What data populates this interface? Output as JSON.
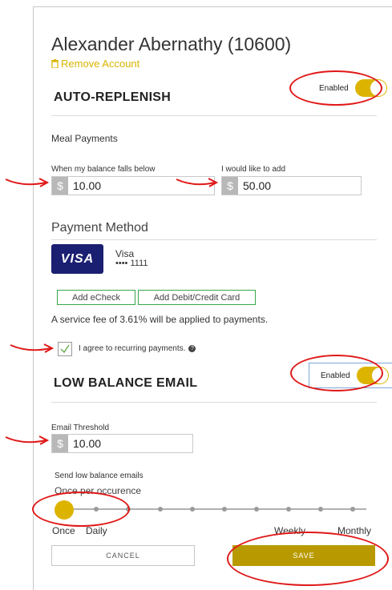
{
  "account": {
    "title": "Alexander Abernathy (10600)",
    "remove_label": "Remove Account"
  },
  "auto_replenish": {
    "heading": "AUTO-REPLENISH",
    "toggle_label": "Enabled",
    "meal_payments_label": "Meal Payments",
    "balance_falls_label": "When my balance falls below",
    "balance_falls_value": "10.00",
    "add_label": "I would like to add",
    "add_value": "50.00",
    "currency_symbol": "$"
  },
  "payment_method": {
    "heading": "Payment Method",
    "card_brand_logo": "VISA",
    "card_name": "Visa",
    "card_masked": "•••• 1111",
    "add_echeck_label": "Add eCheck",
    "add_card_label": "Add Debit/Credit Card",
    "fee_notice": "A service fee of 3.61% will be applied to payments.",
    "agree_label": "I agree to recurring payments.",
    "agree_checked": true,
    "help_icon": "question-circle-icon"
  },
  "low_balance": {
    "heading": "LOW BALANCE EMAIL",
    "toggle_label": "Enabled",
    "threshold_label": "Email Threshold",
    "threshold_value": "10.00",
    "currency_symbol": "$",
    "send_label": "Send low balance emails",
    "frequency_value": "Once per occurence",
    "slider_labels": {
      "once": "Once",
      "daily": "Daily",
      "weekly": "Weekly",
      "monthly": "Monthly"
    },
    "selected_index": 0
  },
  "actions": {
    "cancel_label": "CANCEL",
    "save_label": "SAVE"
  },
  "colors": {
    "accent": "#dcb400",
    "save": "#b89a00",
    "green": "#39a64a",
    "annotation": "#e01818",
    "visa": "#1a1f71"
  }
}
